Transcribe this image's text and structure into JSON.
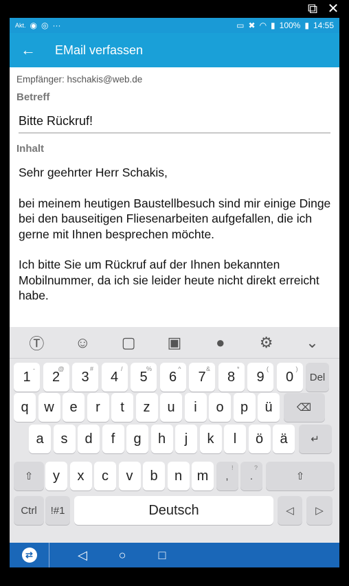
{
  "window": {
    "popout_icon": "external-link-icon",
    "close_icon": "close-icon"
  },
  "statusbar": {
    "left_tiny": "Akt.",
    "right_text": "100%",
    "time": "14:55"
  },
  "appbar": {
    "title": "EMail verfassen"
  },
  "recipient": "Empfänger: hschakis@web.de",
  "subject_label": "Betreff",
  "subject_value": "Bitte Rückruf!",
  "content_label": "Inhalt",
  "body": {
    "p1": "Sehr geehrter Herr Schakis,",
    "p2": "bei meinem heutigen Baustellbesuch sind mir einige Dinge bei den bauseitigen Fliesenarbeiten aufgefallen, die ich gerne mit Ihnen besprechen möchte.",
    "p3": "Ich bitte Sie um Rückruf auf der Ihnen bekannten Mobilnummer, da ich sie leider heute nicht direkt erreicht habe."
  },
  "keyboard": {
    "toolbar": [
      "translate-icon",
      "emoji-icon",
      "sticker-icon",
      "gif-icon",
      "mic-icon",
      "gear-icon",
      "chevron-down-icon"
    ],
    "numbers": [
      {
        "k": "1",
        "s": "-"
      },
      {
        "k": "2",
        "s": "@"
      },
      {
        "k": "3",
        "s": "#"
      },
      {
        "k": "4",
        "s": "/"
      },
      {
        "k": "5",
        "s": "%"
      },
      {
        "k": "6",
        "s": "^"
      },
      {
        "k": "7",
        "s": "&"
      },
      {
        "k": "8",
        "s": "*"
      },
      {
        "k": "9",
        "s": "("
      },
      {
        "k": "0",
        "s": ")"
      }
    ],
    "del": "Del",
    "row1": [
      "q",
      "w",
      "e",
      "r",
      "t",
      "z",
      "u",
      "i",
      "o",
      "p",
      "ü"
    ],
    "row2": [
      "a",
      "s",
      "d",
      "f",
      "g",
      "h",
      "j",
      "k",
      "l",
      "ö",
      "ä"
    ],
    "row3": [
      "y",
      "x",
      "c",
      "v",
      "b",
      "n",
      "m"
    ],
    "comma_main": ",",
    "comma_sub": "!",
    "period_main": ".",
    "period_sub": "?",
    "ctrl": "Ctrl",
    "sym": "!#1",
    "space": "Deutsch"
  }
}
